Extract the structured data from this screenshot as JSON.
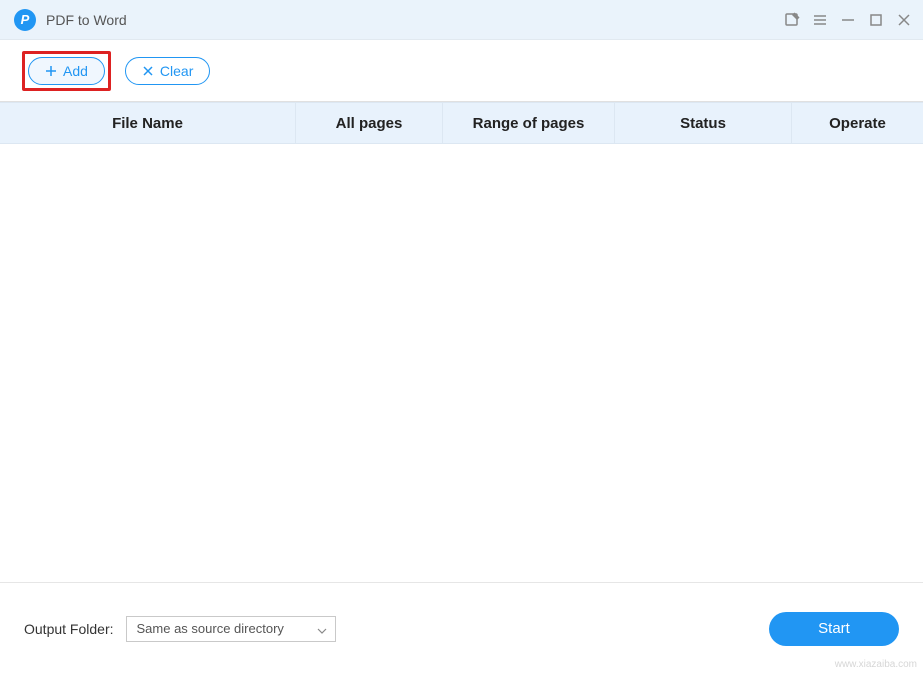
{
  "titlebar": {
    "title": "PDF to Word"
  },
  "toolbar": {
    "add_label": "Add",
    "clear_label": "Clear"
  },
  "table": {
    "headers": {
      "filename": "File Name",
      "allpages": "All pages",
      "range": "Range of pages",
      "status": "Status",
      "operate": "Operate"
    },
    "rows": []
  },
  "footer": {
    "output_label": "Output Folder:",
    "folder_selected": "Same as source directory",
    "start_label": "Start"
  },
  "watermark": "www.xiazaiba.com"
}
